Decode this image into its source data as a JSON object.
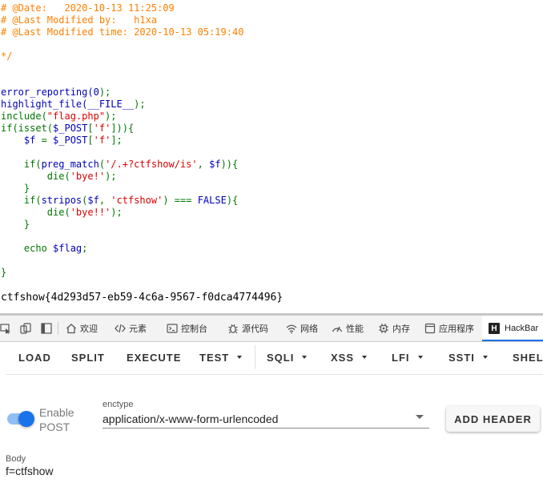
{
  "code": {
    "lines": [
      {
        "tokens": [
          {
            "t": "# @Date:   2020-10-13 11:25:09",
            "c": "cmt"
          }
        ]
      },
      {
        "tokens": [
          {
            "t": "# @Last Modified by:   h1xa",
            "c": "cmt"
          }
        ]
      },
      {
        "tokens": [
          {
            "t": "# @Last Modified time: 2020-10-13 05:19:40",
            "c": "cmt"
          }
        ]
      },
      {
        "tokens": []
      },
      {
        "tokens": [
          {
            "t": "*/",
            "c": "cmt"
          }
        ]
      },
      {
        "tokens": []
      },
      {
        "tokens": []
      },
      {
        "tokens": [
          {
            "t": "error_reporting(",
            "c": "df"
          },
          {
            "t": "0",
            "c": "df"
          },
          {
            "t": ");",
            "c": "kw"
          }
        ]
      },
      {
        "tokens": [
          {
            "t": "highlight_file(",
            "c": "df"
          },
          {
            "t": "__FILE__",
            "c": "df"
          },
          {
            "t": ");",
            "c": "kw"
          }
        ]
      },
      {
        "tokens": [
          {
            "t": "include(",
            "c": "kw"
          },
          {
            "t": "\"flag.php\"",
            "c": "str"
          },
          {
            "t": ");",
            "c": "kw"
          }
        ]
      },
      {
        "tokens": [
          {
            "t": "if(isset(",
            "c": "kw"
          },
          {
            "t": "$_POST",
            "c": "df"
          },
          {
            "t": "[",
            "c": "kw"
          },
          {
            "t": "'f'",
            "c": "str"
          },
          {
            "t": "])){",
            "c": "kw"
          }
        ]
      },
      {
        "tokens": [
          {
            "t": "    $f ",
            "c": "df"
          },
          {
            "t": "= ",
            "c": "kw"
          },
          {
            "t": "$_POST",
            "c": "df"
          },
          {
            "t": "[",
            "c": "kw"
          },
          {
            "t": "'f'",
            "c": "str"
          },
          {
            "t": "];",
            "c": "kw"
          }
        ]
      },
      {
        "tokens": []
      },
      {
        "tokens": [
          {
            "t": "    if(",
            "c": "kw"
          },
          {
            "t": "preg_match",
            "c": "df"
          },
          {
            "t": "(",
            "c": "kw"
          },
          {
            "t": "'/.+?ctfshow/is'",
            "c": "str"
          },
          {
            "t": ", ",
            "c": "kw"
          },
          {
            "t": "$f",
            "c": "df"
          },
          {
            "t": ")){",
            "c": "kw"
          }
        ]
      },
      {
        "tokens": [
          {
            "t": "        die(",
            "c": "kw"
          },
          {
            "t": "'bye!'",
            "c": "str"
          },
          {
            "t": ");",
            "c": "kw"
          }
        ]
      },
      {
        "tokens": [
          {
            "t": "    }",
            "c": "kw"
          }
        ]
      },
      {
        "tokens": [
          {
            "t": "    if(",
            "c": "kw"
          },
          {
            "t": "stripos",
            "c": "df"
          },
          {
            "t": "(",
            "c": "kw"
          },
          {
            "t": "$f",
            "c": "df"
          },
          {
            "t": ", ",
            "c": "kw"
          },
          {
            "t": "'ctfshow'",
            "c": "str"
          },
          {
            "t": ") === ",
            "c": "kw"
          },
          {
            "t": "FALSE",
            "c": "df"
          },
          {
            "t": "){",
            "c": "kw"
          }
        ]
      },
      {
        "tokens": [
          {
            "t": "        die(",
            "c": "kw"
          },
          {
            "t": "'bye!!'",
            "c": "str"
          },
          {
            "t": ");",
            "c": "kw"
          }
        ]
      },
      {
        "tokens": [
          {
            "t": "    }",
            "c": "kw"
          }
        ]
      },
      {
        "tokens": []
      },
      {
        "tokens": [
          {
            "t": "    echo ",
            "c": "kw"
          },
          {
            "t": "$flag",
            "c": "df"
          },
          {
            "t": ";",
            "c": "kw"
          }
        ]
      },
      {
        "tokens": []
      },
      {
        "tokens": [
          {
            "t": "}",
            "c": "kw"
          }
        ]
      }
    ],
    "flag_output": "ctfshow{4d293d57-eb59-4c6a-9567-f0dca4774496}"
  },
  "devtools": {
    "tabs": [
      {
        "id": "welcome",
        "label": "欢迎",
        "icon": "home-icon"
      },
      {
        "id": "elements",
        "label": "元素",
        "icon": "code-icon"
      },
      {
        "id": "console",
        "label": "控制台",
        "icon": "console-icon"
      },
      {
        "id": "sources",
        "label": "源代码",
        "icon": "bug-icon"
      },
      {
        "id": "network",
        "label": "网络",
        "icon": "wifi-icon"
      },
      {
        "id": "performance",
        "label": "性能",
        "icon": "gauge-icon"
      },
      {
        "id": "memory",
        "label": "内存",
        "icon": "chip-icon"
      },
      {
        "id": "application",
        "label": "应用程序",
        "icon": "window-icon"
      },
      {
        "id": "hackbar",
        "label": "HackBar",
        "icon": "hackbar-logo-icon",
        "logo_letter": "H",
        "active": true
      }
    ]
  },
  "hackbar": {
    "toolbar": [
      {
        "label": "LOAD",
        "dropdown": false
      },
      {
        "label": "SPLIT",
        "dropdown": false
      },
      {
        "label": "EXECUTE",
        "dropdown": false
      },
      {
        "label": "TEST",
        "dropdown": true
      },
      {
        "label": "SQLI",
        "dropdown": true
      },
      {
        "label": "XSS",
        "dropdown": true
      },
      {
        "label": "LFI",
        "dropdown": true
      },
      {
        "label": "SSTI",
        "dropdown": true
      },
      {
        "label": "SHELL",
        "dropdown": false
      }
    ],
    "enable_post": {
      "line1": "Enable",
      "line2": "POST",
      "on": true
    },
    "enctype": {
      "label": "enctype",
      "value": "application/x-www-form-urlencoded"
    },
    "add_header_label": "ADD HEADER",
    "body": {
      "label": "Body",
      "value": "f=ctfshow"
    }
  },
  "colors": {
    "accent": "#1a73e8",
    "php_comment": "#ff8000",
    "php_keyword": "#007700",
    "php_default": "#0000bb",
    "php_string": "#dd0000"
  }
}
